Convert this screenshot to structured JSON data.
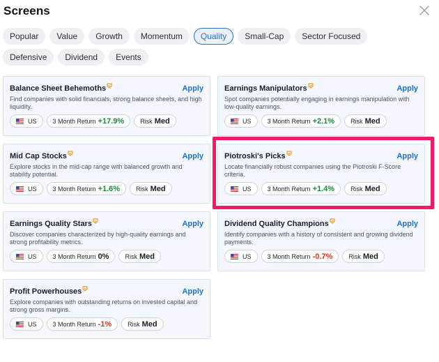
{
  "header": {
    "title": "Screens",
    "close_icon": "close-icon"
  },
  "tabs": [
    {
      "label": "Popular",
      "active": false
    },
    {
      "label": "Value",
      "active": false
    },
    {
      "label": "Growth",
      "active": false
    },
    {
      "label": "Momentum",
      "active": false
    },
    {
      "label": "Quality",
      "active": true
    },
    {
      "label": "Small-Cap",
      "active": false
    },
    {
      "label": "Sector Focused",
      "active": false
    },
    {
      "label": "Defensive",
      "active": false
    },
    {
      "label": "Dividend",
      "active": false
    },
    {
      "label": "Events",
      "active": false
    }
  ],
  "cards": [
    {
      "title": "Balance Sheet Behemoths",
      "apply": "Apply",
      "desc": "Find companies with solid financials, strong balance sheets, and high liquidity.",
      "region": "US",
      "return_label": "3 Month Return",
      "return_value": "+17.9%",
      "return_dir": "pos",
      "risk_label": "Risk",
      "risk_value": "Med"
    },
    {
      "title": "Earnings Manipulators",
      "apply": "Apply",
      "desc": "Spot companies potentially engaging in earnings manipulation with low-quality earnings.",
      "region": "US",
      "return_label": "3 Month Return",
      "return_value": "+2.1%",
      "return_dir": "pos",
      "risk_label": "Risk",
      "risk_value": "Med"
    },
    {
      "title": "Mid Cap Stocks",
      "apply": "Apply",
      "desc": "Explore stocks in the mid-cap range with balanced growth and stability potential.",
      "region": "US",
      "return_label": "3 Month Return",
      "return_value": "+1.6%",
      "return_dir": "pos",
      "risk_label": "Risk",
      "risk_value": "Med"
    },
    {
      "title": "Piotroski's Picks",
      "apply": "Apply",
      "desc": "Locate financially robust companies using the Piotroski F-Score criteria.",
      "region": "US",
      "return_label": "3 Month Return",
      "return_value": "+1.4%",
      "return_dir": "pos",
      "risk_label": "Risk",
      "risk_value": "Med"
    },
    {
      "title": "Earnings Quality Stars",
      "apply": "Apply",
      "desc": "Discover companies characterized by high-quality earnings and strong profitability metrics.",
      "region": "US",
      "return_label": "3 Month Return",
      "return_value": "0%",
      "return_dir": "neu",
      "risk_label": "Risk",
      "risk_value": "Med"
    },
    {
      "title": "Dividend Quality Champions",
      "apply": "Apply",
      "desc": "Identify companies with a history of consistent and growing dividend payments.",
      "region": "US",
      "return_label": "3 Month Return",
      "return_value": "-0.7%",
      "return_dir": "neg",
      "risk_label": "Risk",
      "risk_value": "Med"
    },
    {
      "title": "Profit Powerhouses",
      "apply": "Apply",
      "desc": "Explore companies with outstanding returns on invested capital and strong gross margins.",
      "region": "US",
      "return_label": "3 Month Return",
      "return_value": "-1%",
      "return_dir": "neg",
      "risk_label": "Risk",
      "risk_value": "Med"
    }
  ],
  "colors": {
    "accent": "#1e6fd0",
    "positive": "#1a8a3a",
    "negative": "#d6331f",
    "highlight": "#f4196a",
    "badge": "#f29a2e"
  },
  "icons": {
    "premium_badge": "premium-badge-icon",
    "flag": "us-flag-icon"
  }
}
